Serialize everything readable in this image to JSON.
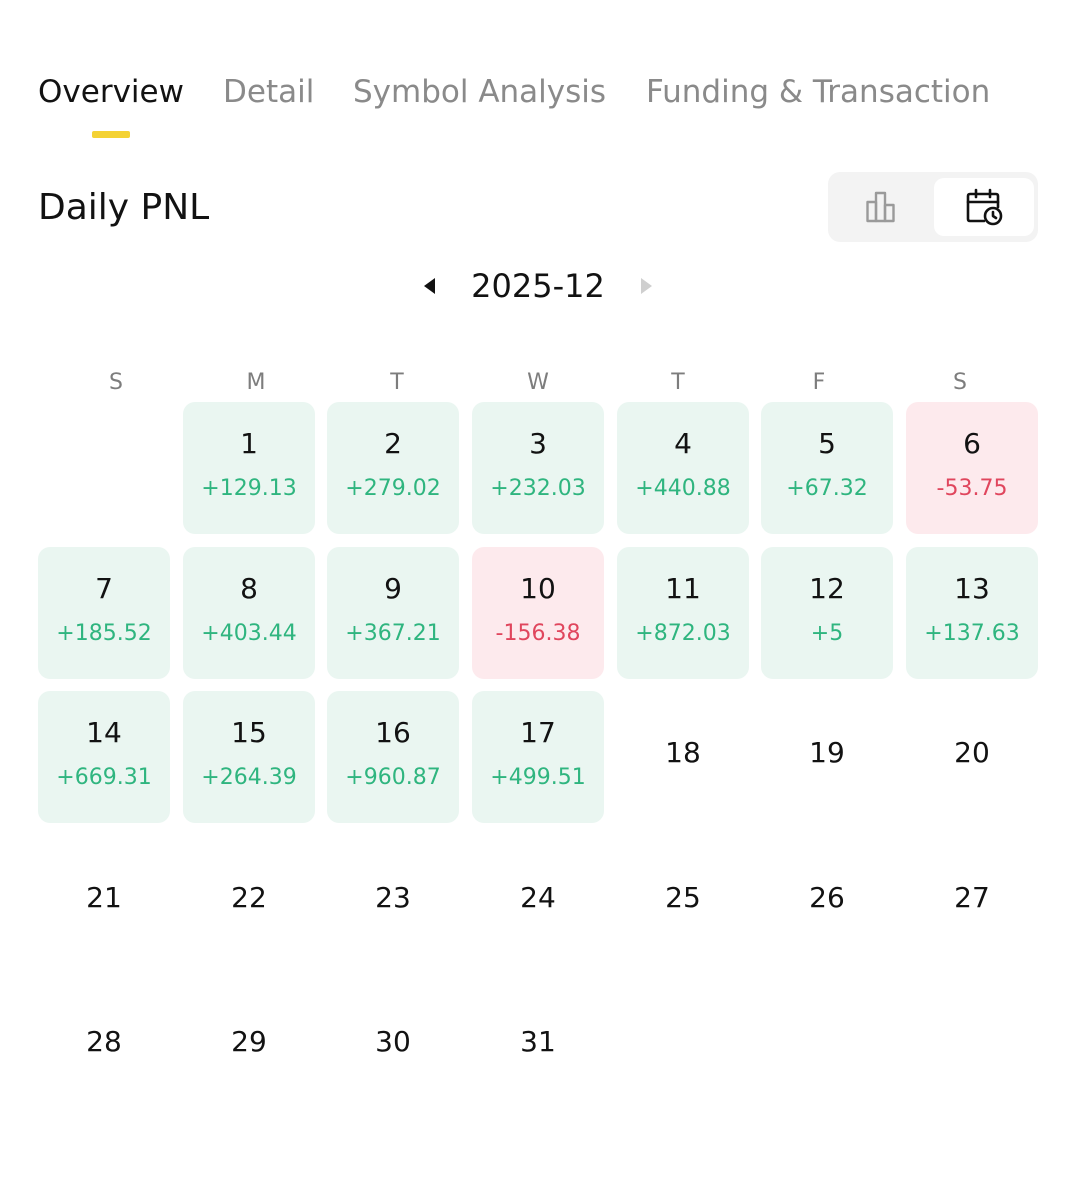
{
  "tabs": [
    {
      "label": "Overview",
      "active": true
    },
    {
      "label": "Detail",
      "active": false
    },
    {
      "label": "Symbol Analysis",
      "active": false
    },
    {
      "label": "Funding & Transaction",
      "active": false
    }
  ],
  "section": {
    "title": "Daily PNL"
  },
  "view_toggle": {
    "chart_icon": "bar-chart-icon",
    "calendar_icon": "calendar-clock-icon",
    "selected": "calendar"
  },
  "month": {
    "label": "2025-12"
  },
  "weekdays": [
    "S",
    "M",
    "T",
    "W",
    "T",
    "F",
    "S"
  ],
  "calendar": {
    "first_weekday_index": 1,
    "days": [
      {
        "day": "1",
        "pnl": "+129.13"
      },
      {
        "day": "2",
        "pnl": "+279.02"
      },
      {
        "day": "3",
        "pnl": "+232.03"
      },
      {
        "day": "4",
        "pnl": "+440.88"
      },
      {
        "day": "5",
        "pnl": "+67.32"
      },
      {
        "day": "6",
        "pnl": "-53.75"
      },
      {
        "day": "7",
        "pnl": "+185.52"
      },
      {
        "day": "8",
        "pnl": "+403.44"
      },
      {
        "day": "9",
        "pnl": "+367.21"
      },
      {
        "day": "10",
        "pnl": "-156.38"
      },
      {
        "day": "11",
        "pnl": "+872.03"
      },
      {
        "day": "12",
        "pnl": "+5"
      },
      {
        "day": "13",
        "pnl": "+137.63"
      },
      {
        "day": "14",
        "pnl": "+669.31"
      },
      {
        "day": "15",
        "pnl": "+264.39"
      },
      {
        "day": "16",
        "pnl": "+960.87"
      },
      {
        "day": "17",
        "pnl": "+499.51"
      },
      {
        "day": "18",
        "pnl": ""
      },
      {
        "day": "19",
        "pnl": ""
      },
      {
        "day": "20",
        "pnl": ""
      },
      {
        "day": "21",
        "pnl": ""
      },
      {
        "day": "22",
        "pnl": ""
      },
      {
        "day": "23",
        "pnl": ""
      },
      {
        "day": "24",
        "pnl": ""
      },
      {
        "day": "25",
        "pnl": ""
      },
      {
        "day": "26",
        "pnl": ""
      },
      {
        "day": "27",
        "pnl": ""
      },
      {
        "day": "28",
        "pnl": ""
      },
      {
        "day": "29",
        "pnl": ""
      },
      {
        "day": "30",
        "pnl": ""
      },
      {
        "day": "31",
        "pnl": ""
      }
    ]
  },
  "colors": {
    "accent": "#f4d234",
    "positive_text": "#2fb57f",
    "positive_bg": "#eaf6f1",
    "negative_text": "#e0465d",
    "negative_bg": "#fdeaed"
  }
}
